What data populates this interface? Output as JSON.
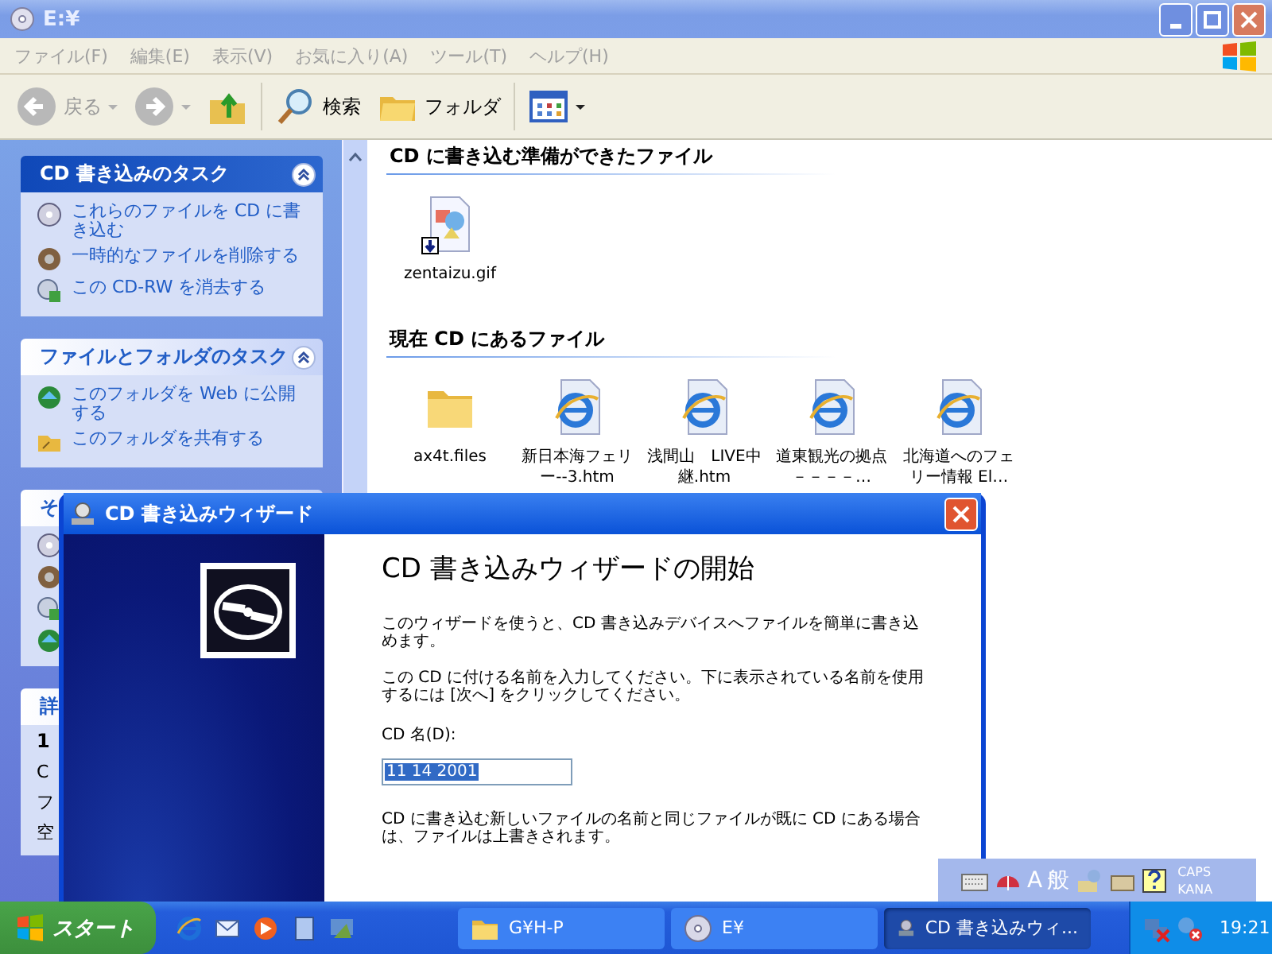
{
  "window": {
    "title": "E:¥"
  },
  "menu": [
    "ファイル(F)",
    "編集(E)",
    "表示(V)",
    "お気に入り(A)",
    "ツール(T)",
    "ヘルプ(H)"
  ],
  "toolbar": [
    {
      "kind": "back",
      "label": "戻る",
      "disabled": true
    },
    {
      "kind": "forward",
      "disabled": true
    },
    {
      "kind": "up"
    },
    {
      "kind": "search",
      "label": "検索"
    },
    {
      "kind": "folders",
      "label": "フォルダ"
    },
    {
      "kind": "views"
    }
  ],
  "task_panes": [
    {
      "kind": "special",
      "title": "CD 書き込みのタスク",
      "items": [
        {
          "text": "これらのファイルを CD に書き込む"
        },
        {
          "text": "一時的なファイルを削除する"
        },
        {
          "text": "この CD-RW を消去する"
        }
      ]
    },
    {
      "kind": "normal",
      "title": "ファイルとフォルダのタスク",
      "items": [
        {
          "text": "このフォルダを Web に公開する"
        },
        {
          "text": "このフォルダを共有する"
        }
      ]
    },
    {
      "kind": "normal",
      "title": "そ",
      "items": [
        {
          "kind": "link"
        },
        {
          "kind": "link"
        },
        {
          "kind": "link"
        },
        {
          "kind": "link"
        }
      ]
    },
    {
      "kind": "details",
      "title": "詳",
      "lines": [
        {
          "kind": "name",
          "text": "1"
        },
        {
          "kind": "info",
          "text": "C"
        },
        {
          "kind": "info",
          "text": "フ"
        },
        {
          "kind": "info",
          "text": "空"
        }
      ]
    }
  ],
  "sections": [
    {
      "heading": "CD に書き込む準備ができたファイル",
      "files": [
        {
          "kind": "image",
          "name": "zentaizu.gif",
          "pending": true
        }
      ]
    },
    {
      "heading": "現在 CD にあるファイル",
      "files": [
        {
          "kind": "folder",
          "name": "ax4t.files",
          "pending": false
        },
        {
          "kind": "web",
          "name": "新日本海フェリー--3.htm",
          "pending": false
        },
        {
          "kind": "web",
          "name": "浅間山　LIVE中継.htm",
          "pending": false
        },
        {
          "kind": "web",
          "name": "道東観光の拠点－－－－…",
          "pending": false
        },
        {
          "kind": "web",
          "name": "北海道へのフェリー情報 El…",
          "pending": false
        }
      ]
    }
  ],
  "wizard": {
    "title": "CD 書き込みウィザード",
    "heading": "CD 書き込みウィザードの開始",
    "paragraphs": [
      "このウィザードを使うと、CD 書き込みデバイスへファイルを簡単に書き込めます。",
      "この CD に付ける名前を入力してください。下に表示されている名前を使用するには [次へ] をクリックしてください。"
    ],
    "field_label": "CD 名(D):",
    "field_value": "11 14 2001",
    "note": "CD に書き込む新しいファイルの名前と同じファイルが既に CD にある場合は、ファイルは上書きされます。"
  },
  "language_bar": {
    "mode": "A",
    "ime": "般",
    "caps": "CAPS",
    "kana": "KANA"
  },
  "taskbar": {
    "start": "スタート",
    "quick_launch": [
      {
        "kind": "ie"
      },
      {
        "kind": "mail"
      },
      {
        "kind": "media"
      },
      {
        "kind": "doc"
      },
      {
        "kind": "desktop"
      }
    ],
    "tasks": [
      {
        "kind": "folder",
        "label": "G¥H-P",
        "selected": false
      },
      {
        "kind": "cd",
        "label": "E¥",
        "selected": false
      },
      {
        "kind": "writer",
        "label": "CD 書き込みウィ...",
        "selected": true
      }
    ],
    "clock": "19:21"
  }
}
